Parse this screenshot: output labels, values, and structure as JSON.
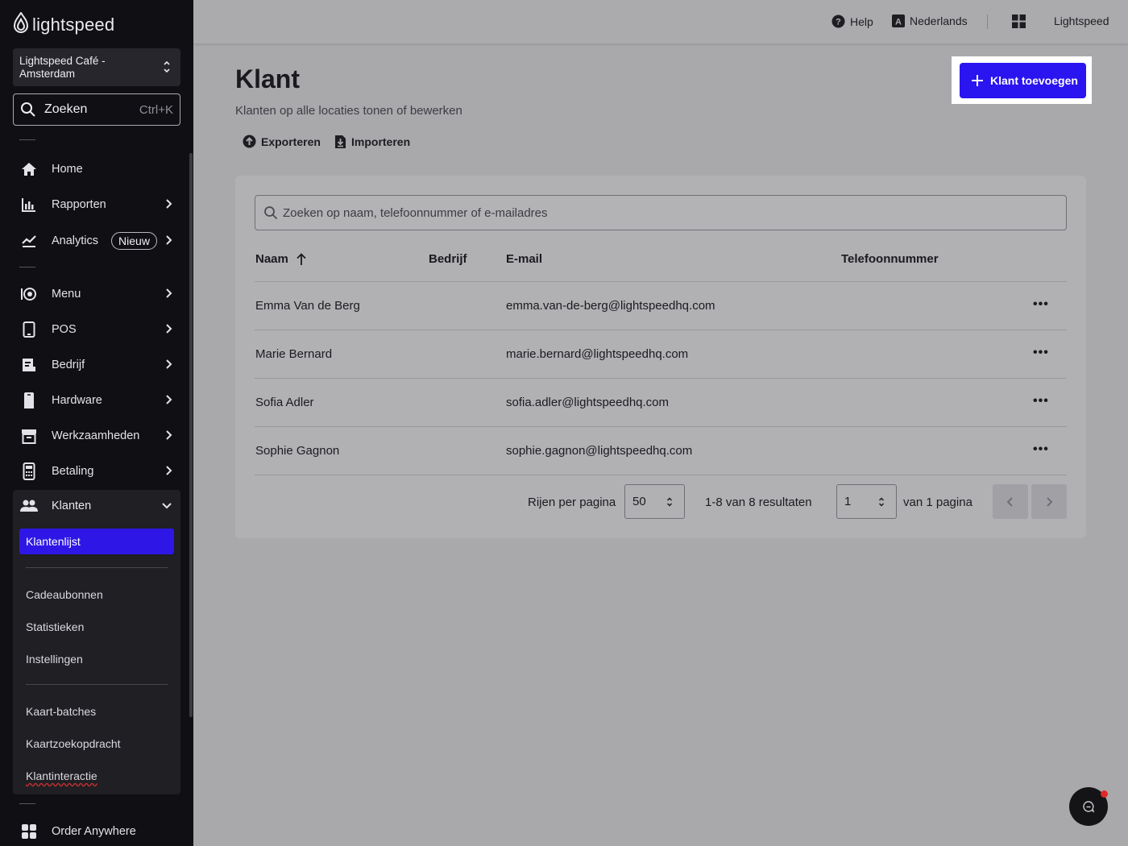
{
  "brand": {
    "logo_text": "lightspeed",
    "accent": "#2a14f0"
  },
  "location": {
    "name": "Lightspeed Café - Amsterdam"
  },
  "search": {
    "label": "Zoeken",
    "shortcut": "Ctrl+K"
  },
  "sidebar": {
    "items": [
      {
        "label": "Home",
        "icon": "home-icon"
      },
      {
        "label": "Rapporten",
        "icon": "bar-chart-icon"
      },
      {
        "label": "Analytics",
        "icon": "trend-icon",
        "badge": "Nieuw"
      },
      {
        "label": "Menu",
        "icon": "menu-icon"
      },
      {
        "label": "POS",
        "icon": "tablet-icon"
      },
      {
        "label": "Bedrijf",
        "icon": "business-icon"
      },
      {
        "label": "Hardware",
        "icon": "hardware-icon"
      },
      {
        "label": "Werkzaamheden",
        "icon": "archive-icon"
      },
      {
        "label": "Betaling",
        "icon": "payment-terminal-icon"
      }
    ],
    "customers": {
      "label": "Klanten",
      "active": "Klantenlijst",
      "group1": [
        "Cadeaubonnen",
        "Statistieken",
        "Instellingen"
      ],
      "group2": [
        "Kaart-batches",
        "Kaartzoekopdracht",
        "Klantinteractie"
      ]
    },
    "bottom": {
      "label": "Order Anywhere"
    }
  },
  "topbar": {
    "help": "Help",
    "language": "Nederlands",
    "account": "Lightspeed"
  },
  "page": {
    "title": "Klant",
    "subtitle": "Klanten op alle locaties tonen of bewerken",
    "export": "Exporteren",
    "import": "Importeren",
    "add_button": "Klant toevoegen"
  },
  "table": {
    "search_placeholder": "Zoeken op naam, telefoonnummer of e-mailadres",
    "columns": [
      "Naam",
      "Bedrijf",
      "E-mail",
      "Telefoonnummer"
    ],
    "rows": [
      {
        "name": "Emma Van de Berg",
        "company": "",
        "email": "emma.van-de-berg@lightspeedhq.com",
        "phone": ""
      },
      {
        "name": "Marie Bernard",
        "company": "",
        "email": "marie.bernard@lightspeedhq.com",
        "phone": ""
      },
      {
        "name": "Sofia Adler",
        "company": "",
        "email": "sofia.adler@lightspeedhq.com",
        "phone": ""
      },
      {
        "name": "Sophie Gagnon",
        "company": "",
        "email": "sophie.gagnon@lightspeedhq.com",
        "phone": ""
      }
    ],
    "more": "•••"
  },
  "pagination": {
    "rows_label": "Rijen per pagina",
    "rows_value": "50",
    "results": "1-8 van 8 resultaten",
    "page_value": "1",
    "of_pages": "van 1 pagina"
  }
}
